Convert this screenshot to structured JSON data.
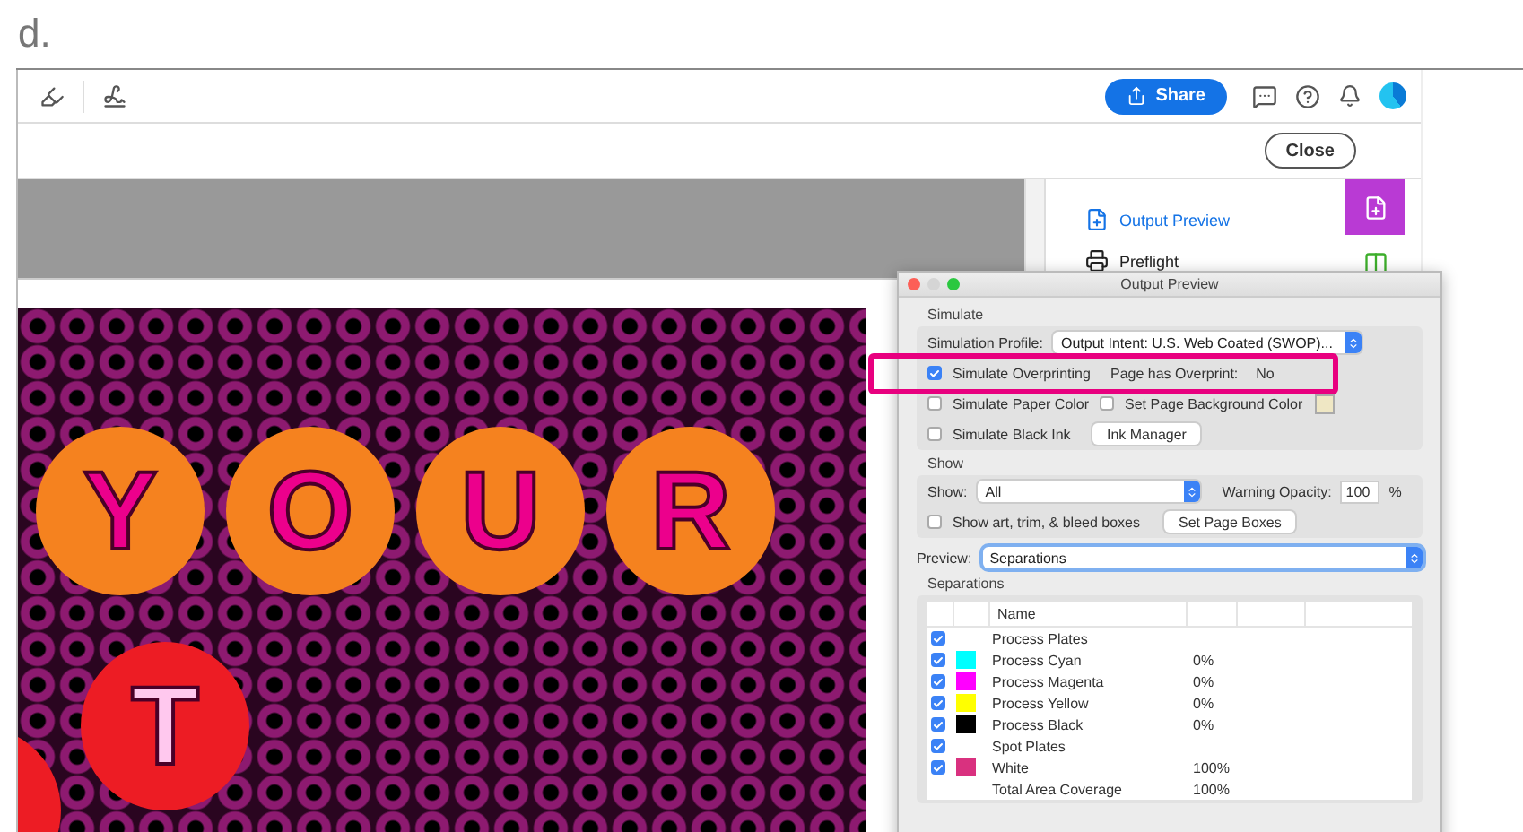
{
  "label": "d.",
  "toolbar": {
    "share": "Share"
  },
  "close": "Close",
  "tools_panel": {
    "items": [
      {
        "label": "Output Preview",
        "selected": true
      },
      {
        "label": "Preflight",
        "selected": false
      }
    ]
  },
  "rail": [
    {
      "selected": true
    },
    {
      "selected": false
    }
  ],
  "artwork": {
    "letters": [
      {
        "text": "Y",
        "color": "#f5821f"
      },
      {
        "text": "O",
        "color": "#f5821f"
      },
      {
        "text": "U",
        "color": "#f5821f"
      },
      {
        "text": "R",
        "color": "#f5821f"
      },
      {
        "text": "T",
        "color": "#ed1c24"
      }
    ]
  },
  "dialog": {
    "title": "Output Preview",
    "simulate": {
      "heading": "Simulate",
      "profile_label": "Simulation Profile:",
      "profile_value": "Output Intent: U.S. Web Coated (SWOP)...",
      "overprint": {
        "label": "Simulate Overprinting",
        "checked": true
      },
      "page_overprint_label": "Page has Overprint:",
      "page_overprint_value": "No",
      "paper_color": {
        "label": "Simulate Paper Color",
        "checked": false
      },
      "page_background": {
        "label": "Set Page Background Color",
        "checked": false
      },
      "black_ink": {
        "label": "Simulate Black Ink",
        "checked": false
      },
      "ink_manager": "Ink Manager"
    },
    "show": {
      "heading": "Show",
      "show_label": "Show:",
      "show_value": "All",
      "opacity_label": "Warning Opacity:",
      "opacity_value": "100",
      "opacity_unit": "%",
      "boxes": {
        "label": "Show art, trim, & bleed boxes",
        "checked": false
      },
      "page_boxes": "Set Page Boxes"
    },
    "preview": {
      "label": "Preview:",
      "value": "Separations"
    },
    "separations": {
      "heading": "Separations",
      "column": "Name",
      "rows": [
        {
          "kind": "group",
          "name": "Process Plates",
          "checked": true
        },
        {
          "kind": "ink",
          "name": "Process Cyan",
          "checked": true,
          "color": "#00ffff",
          "coverage": "0%"
        },
        {
          "kind": "ink",
          "name": "Process Magenta",
          "checked": true,
          "color": "#ff00ff",
          "coverage": "0%"
        },
        {
          "kind": "ink",
          "name": "Process Yellow",
          "checked": true,
          "color": "#ffff00",
          "coverage": "0%"
        },
        {
          "kind": "ink",
          "name": "Process Black",
          "checked": true,
          "color": "#000000",
          "coverage": "0%"
        },
        {
          "kind": "group",
          "name": "Spot Plates",
          "checked": true
        },
        {
          "kind": "ink",
          "name": "White",
          "checked": true,
          "color": "#d9317f",
          "coverage": "100%"
        },
        {
          "kind": "total",
          "name": "Total Area Coverage",
          "coverage": "100%"
        }
      ]
    }
  }
}
